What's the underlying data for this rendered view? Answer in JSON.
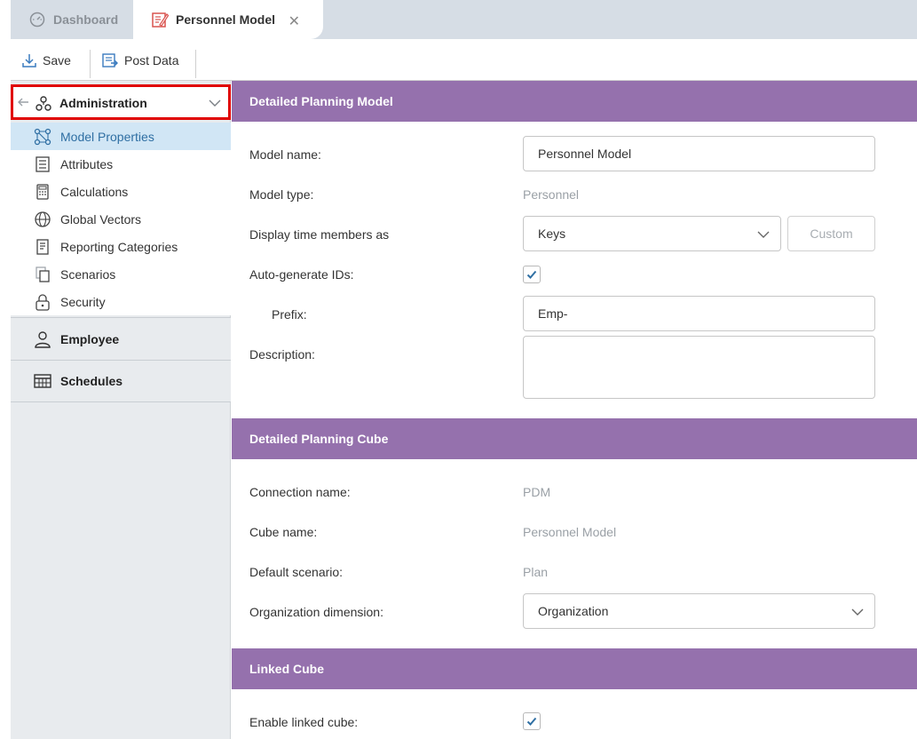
{
  "tabs": [
    {
      "label": "Dashboard",
      "icon": "dashboard-gauge-icon",
      "active": false
    },
    {
      "label": "Personnel Model",
      "icon": "model-edit-icon",
      "active": true
    }
  ],
  "toolbar": {
    "save_label": "Save",
    "post_label": "Post Data"
  },
  "sidebar": {
    "header": "Administration",
    "items": [
      {
        "label": "Model Properties",
        "icon": "model-properties-icon",
        "active": true
      },
      {
        "label": "Attributes",
        "icon": "attributes-list-icon"
      },
      {
        "label": "Calculations",
        "icon": "calculator-icon"
      },
      {
        "label": "Global Vectors",
        "icon": "globe-icon"
      },
      {
        "label": "Reporting Categories",
        "icon": "report-icon"
      },
      {
        "label": "Scenarios",
        "icon": "scenarios-copy-icon"
      },
      {
        "label": "Security",
        "icon": "lock-icon"
      }
    ],
    "sections": [
      {
        "label": "Employee",
        "icon": "person-icon"
      },
      {
        "label": "Schedules",
        "icon": "calendar-grid-icon"
      }
    ]
  },
  "main": {
    "section1": {
      "title": "Detailed Planning Model",
      "model_name_label": "Model name:",
      "model_name_value": "Personnel Model",
      "model_type_label": "Model type:",
      "model_type_value": "Personnel",
      "display_time_label": "Display time members as",
      "display_time_value": "Keys",
      "custom_label": "Custom",
      "auto_ids_label": "Auto-generate IDs:",
      "auto_ids_checked": true,
      "prefix_label": "Prefix:",
      "prefix_value": "Emp-",
      "description_label": "Description:",
      "description_value": ""
    },
    "section2": {
      "title": "Detailed Planning Cube",
      "connection_label": "Connection name:",
      "connection_value": "PDM",
      "cube_label": "Cube name:",
      "cube_value": "Personnel Model",
      "scenario_label": "Default scenario:",
      "scenario_value": "Plan",
      "org_label": "Organization dimension:",
      "org_value": "Organization"
    },
    "section3": {
      "title": "Linked Cube",
      "enable_label": "Enable linked cube:",
      "enable_checked": true
    }
  },
  "colors": {
    "section_header": "#9571ad",
    "highlight_border": "#e00000",
    "active_item_bg": "#d1e6f5",
    "check_color": "#2f6fa3"
  }
}
